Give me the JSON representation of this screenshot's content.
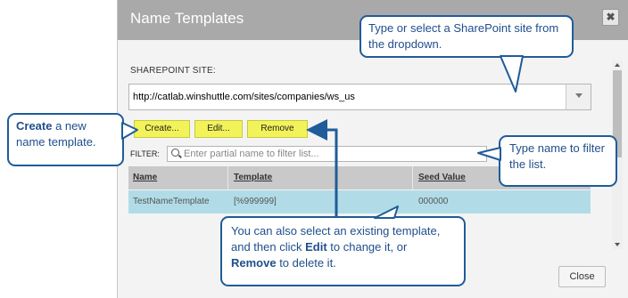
{
  "dialog": {
    "title": "Name Templates",
    "close_glyph": "✖",
    "close_button_label": "Close"
  },
  "sharepoint": {
    "label": "SHAREPOINT SITE:",
    "value": "http://catlab.winshuttle.com/sites/companies/ws_us"
  },
  "toolbar": {
    "create_label": "Create...",
    "edit_label": "Edit...",
    "remove_label": "Remove"
  },
  "filter": {
    "label": "FILTER:",
    "placeholder": "Enter partial name to filter list..."
  },
  "table": {
    "columns": [
      "Name",
      "Template",
      "Seed Value"
    ],
    "rows": [
      [
        "TestNameTemplate",
        "[%999999]",
        "000000"
      ]
    ]
  },
  "callouts": {
    "create": {
      "bold": "Create",
      "rest": " a new name template."
    },
    "site": {
      "text": "Type or select a SharePoint site from the dropdown."
    },
    "filter": {
      "text": "Type name to filter the list."
    },
    "edit": {
      "part1": "You can also select an existing template, and then click ",
      "edit_bold": "Edit",
      "part2": " to change it, or ",
      "remove_bold": "Remove",
      "part3": " to delete it."
    }
  },
  "colors": {
    "accent": "#1f5c99",
    "highlight_button": "#f2f25a",
    "selected_row": "#b1dce7"
  }
}
